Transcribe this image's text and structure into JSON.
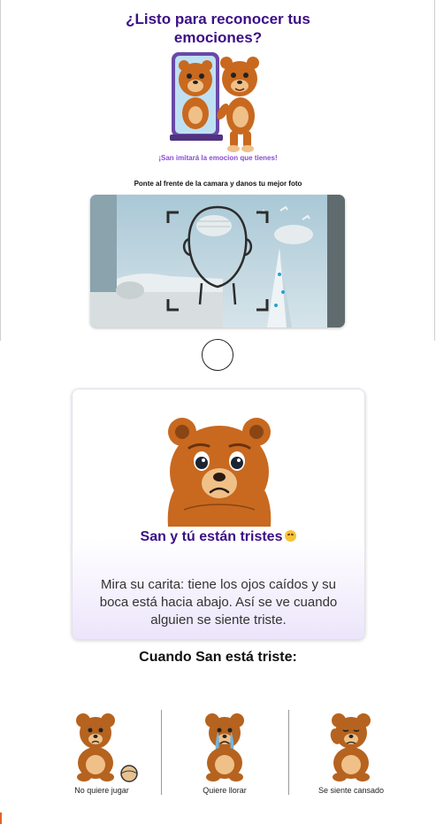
{
  "header": {
    "title_line1": "¿Listo para reconocer tus",
    "title_line2": "emociones?",
    "subtitle": "¡San imitará la emocion que tienes!",
    "camera_hint": "Ponte al frente de la camara y danos tu mejor foto"
  },
  "icons": {
    "hero": "bear-mirror-illustration",
    "preview": "camera-preview",
    "face_guide": "face-scan-frame-icon",
    "shutter": "shutter-button",
    "sad_bear": "sad-bear-illustration",
    "emoji": "disappointed-face-emoji"
  },
  "emotion_card": {
    "title": "San y tú están tristes",
    "description": "Mira su carita: tiene los ojos caídos y su boca está hacia abajo. Así se ve cuando alguien se siente triste."
  },
  "signs": {
    "title": "Cuando San está triste:",
    "items": [
      {
        "label": "No quiere jugar",
        "icon": "bear-with-ball-icon"
      },
      {
        "label": "Quiere llorar",
        "icon": "crying-bear-icon"
      },
      {
        "label": "Se siente cansado",
        "icon": "tired-bear-icon"
      }
    ]
  },
  "colors": {
    "title": "#3b0f86",
    "subtitle": "#8a4cd6",
    "bear_fur": "#c8691f",
    "bear_muzzle": "#f0c089",
    "card_gradient_end": "#ece5fb"
  }
}
